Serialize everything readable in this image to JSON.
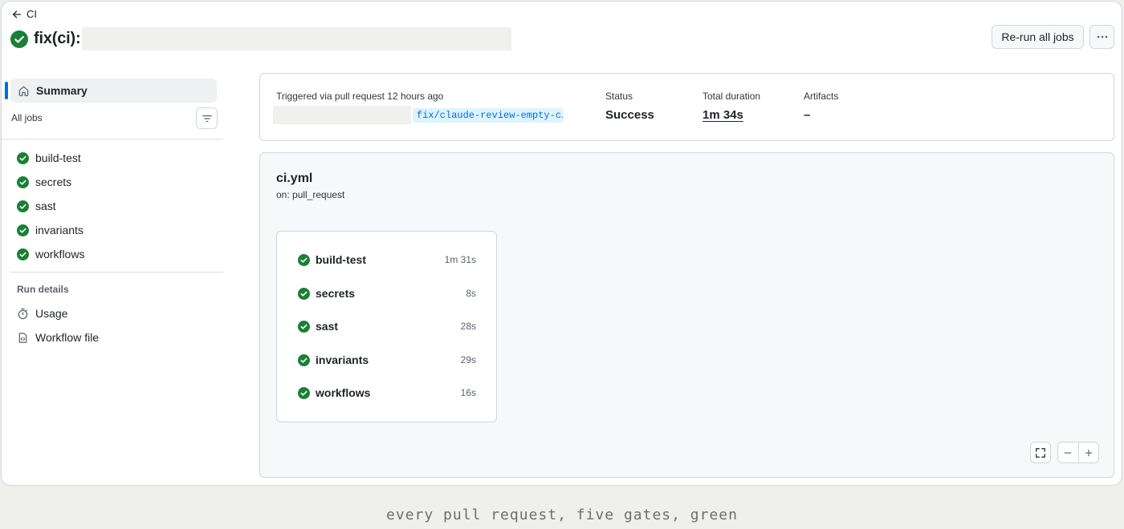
{
  "header": {
    "back_label": "CI",
    "run_title": "fix(ci):",
    "rerun_label": "Re-run all jobs"
  },
  "sidebar": {
    "summary_label": "Summary",
    "all_jobs_label": "All jobs",
    "jobs": [
      {
        "name": "build-test"
      },
      {
        "name": "secrets"
      },
      {
        "name": "sast"
      },
      {
        "name": "invariants"
      },
      {
        "name": "workflows"
      }
    ],
    "run_details_label": "Run details",
    "details": [
      {
        "label": "Usage",
        "icon": "stopwatch-icon"
      },
      {
        "label": "Workflow file",
        "icon": "file-code-icon"
      }
    ]
  },
  "summary": {
    "triggered_text": "Triggered via pull request 12 hours ago",
    "branch": "fix/claude-review-empty-c…",
    "status_label": "Status",
    "status_value": "Success",
    "duration_label": "Total duration",
    "duration_value": "1m 34s",
    "artifacts_label": "Artifacts",
    "artifacts_value": "–"
  },
  "workflow": {
    "file": "ci.yml",
    "trigger": "on: pull_request",
    "jobs": [
      {
        "name": "build-test",
        "duration": "1m 31s"
      },
      {
        "name": "secrets",
        "duration": "8s"
      },
      {
        "name": "sast",
        "duration": "28s"
      },
      {
        "name": "invariants",
        "duration": "29s"
      },
      {
        "name": "workflows",
        "duration": "16s"
      }
    ]
  },
  "caption": "every pull request, five gates, green",
  "colors": {
    "success": "#1a7f37",
    "accent": "#0969da"
  }
}
